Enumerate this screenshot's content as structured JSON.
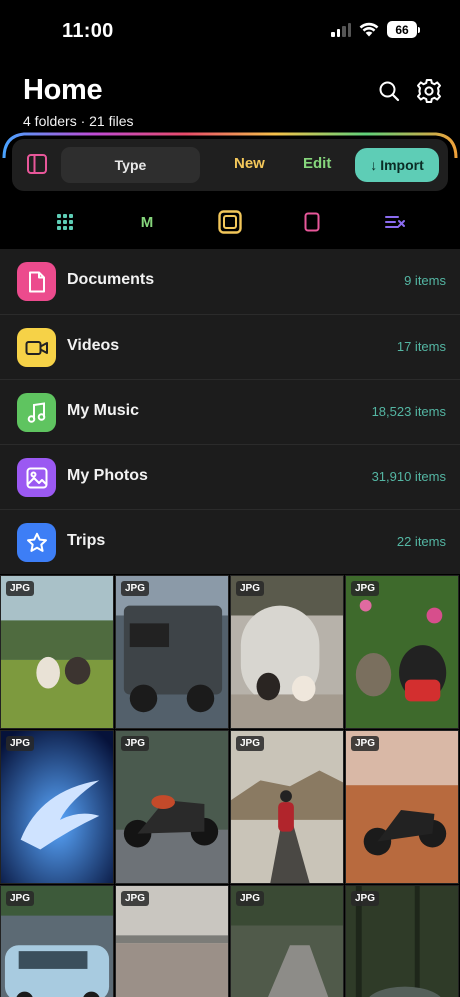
{
  "status": {
    "time": "11:00",
    "battery": "66"
  },
  "header": {
    "title": "Home",
    "subtitle": "4 folders · 21 files"
  },
  "toolbar": {
    "type_label": "Type",
    "new_label": "New",
    "edit_label": "Edit",
    "import_label": "Import"
  },
  "view_modes": {
    "m_label": "M"
  },
  "folders": [
    {
      "name": "Documents",
      "count": "9 items",
      "color": "#ec4b8d",
      "icon": "document-icon"
    },
    {
      "name": "Videos",
      "count": "17 items",
      "color": "#f6d247",
      "icon": "video-camera-icon"
    },
    {
      "name": "My Music",
      "count": "18,523 items",
      "color": "#5fc460",
      "icon": "music-note-icon"
    },
    {
      "name": "My Photos",
      "count": "31,910 items",
      "color": "#9b59f2",
      "icon": "image-icon"
    },
    {
      "name": "Trips",
      "count": "22 items",
      "color": "#3d7ef6",
      "icon": "star-icon"
    }
  ],
  "photos": [
    {
      "badge": "JPG"
    },
    {
      "badge": "JPG"
    },
    {
      "badge": "JPG"
    },
    {
      "badge": "JPG"
    },
    {
      "badge": "JPG"
    },
    {
      "badge": "JPG"
    },
    {
      "badge": "JPG"
    },
    {
      "badge": "JPG"
    },
    {
      "badge": "JPG"
    },
    {
      "badge": "JPG"
    },
    {
      "badge": "JPG"
    },
    {
      "badge": "JPG"
    }
  ],
  "colors": {
    "accent_teal": "#5ecdb6",
    "new_yellow": "#f3c75a",
    "edit_green": "#86d67c",
    "count_teal": "#54b6a3"
  }
}
